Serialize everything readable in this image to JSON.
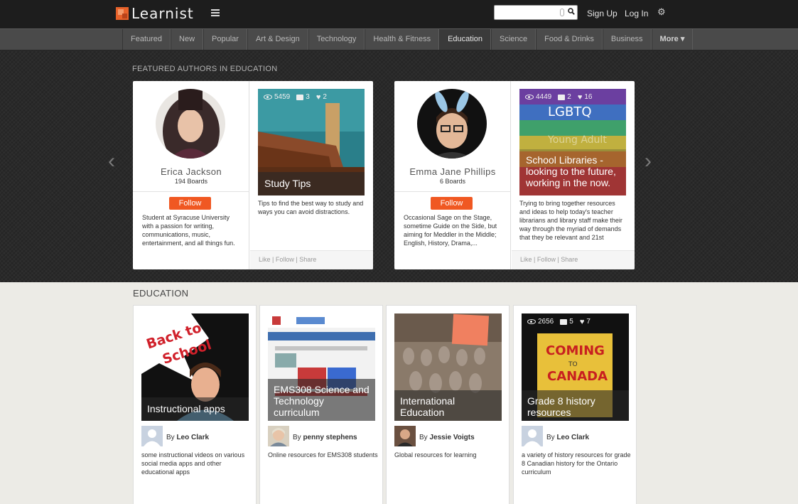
{
  "header": {
    "logo": "Learnist",
    "search": {
      "value": "",
      "placeholder": ""
    },
    "sign_up": "Sign Up",
    "log_in": "Log In"
  },
  "nav": {
    "items": [
      "Featured",
      "New",
      "Popular",
      "Art & Design",
      "Technology",
      "Health & Fitness",
      "Education",
      "Science",
      "Food & Drinks",
      "Business"
    ],
    "active": "Education",
    "more": "More ▾"
  },
  "featured": {
    "title": "FEATURED AUTHORS IN EDUCATION",
    "authors": [
      {
        "name": "Erica Jackson",
        "boards": "194 Boards",
        "follow": "Follow",
        "bio": "Student at Syracuse University with a passion for writing, communications, music, entertainment, and all things fun.",
        "board": {
          "views": "5459",
          "comments": "3",
          "likes": "2",
          "title": "Study Tips",
          "desc": "Tips to find the best way to study and ways you can avoid distractions.",
          "like": "Like",
          "follow": "Follow",
          "share": "Share"
        }
      },
      {
        "name": "Emma Jane Phillips",
        "boards": "6 Boards",
        "follow": "Follow",
        "bio": "Occasional Sage on the Stage, sometime Guide on the Side, but aiming for Meddler in the Middle; English, History, Drama,...",
        "board": {
          "views": "4449",
          "comments": "2",
          "likes": "16",
          "title": "School Libraries - looking to the future, working in the now.",
          "desc": "Trying to bring together resources and ideas to help today's teacher librarians and library staff make their way through the myriad of demands that they be relevant and 21st",
          "like": "Like",
          "follow": "Follow",
          "share": "Share"
        }
      }
    ]
  },
  "education": {
    "title": "EDUCATION",
    "cards": [
      {
        "title": "Instructional apps",
        "by": "By",
        "author": "Leo Clark",
        "desc": "some instructional videos on various social media apps and other educational apps"
      },
      {
        "title": "EMS308 Science and Technology curriculum",
        "by": "By",
        "author": "penny stephens",
        "desc": "Online resources for EMS308 students"
      },
      {
        "title": "International Education",
        "by": "By",
        "author": "Jessie Voigts",
        "desc": "Global resources for learning"
      },
      {
        "title": "Grade 8 history resources",
        "by": "By",
        "author": "Leo Clark",
        "desc": "a variety of history resources for grade 8 Canadian history for the Ontario curriculum",
        "views": "2656",
        "comments": "5",
        "likes": "7"
      }
    ]
  },
  "colors": {
    "accent": "#f05822",
    "header_bg": "#1d1d1d",
    "nav_bg": "#4a4a4a",
    "page_bg": "#ecebe6"
  }
}
